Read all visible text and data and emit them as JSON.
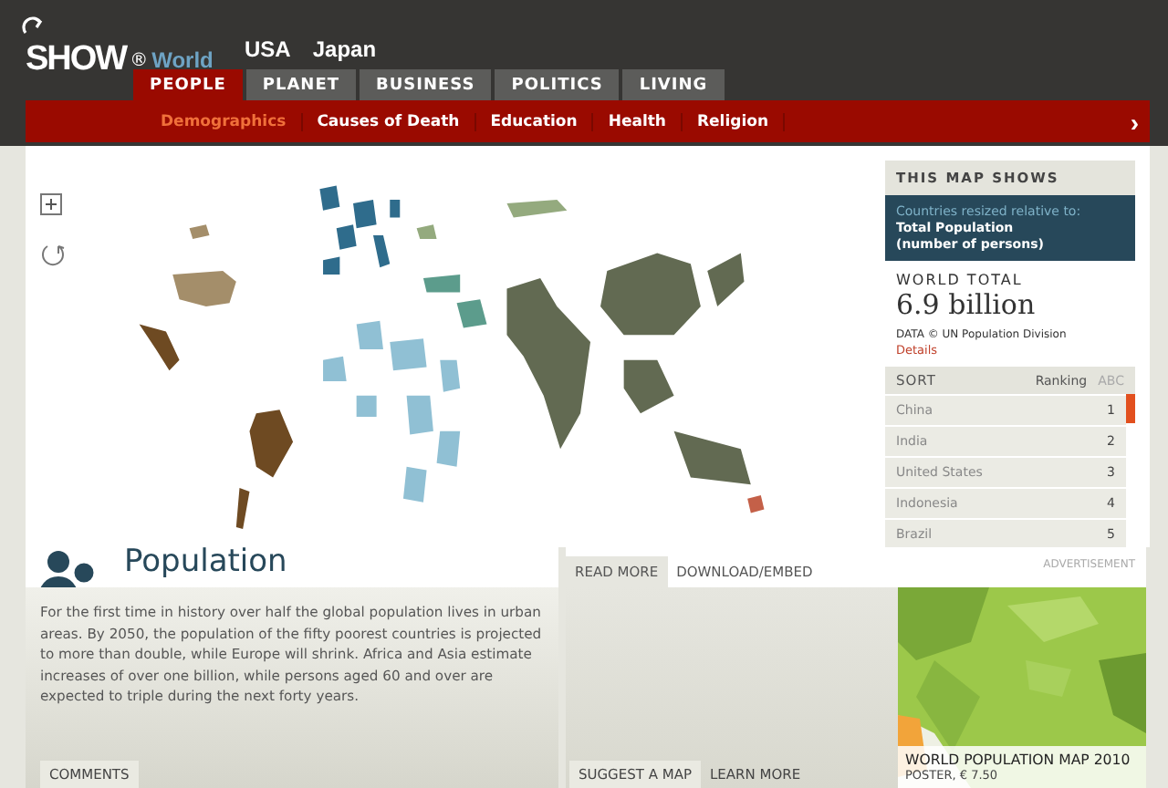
{
  "header": {
    "logo": "SHOW",
    "registered": "®",
    "section": "World",
    "editions": [
      "USA",
      "Japan"
    ]
  },
  "tabs": [
    {
      "label": "PEOPLE",
      "selected": true
    },
    {
      "label": "PLANET",
      "selected": false
    },
    {
      "label": "BUSINESS",
      "selected": false
    },
    {
      "label": "POLITICS",
      "selected": false
    },
    {
      "label": "LIVING",
      "selected": false
    }
  ],
  "subnav": {
    "items": [
      {
        "label": "Demographics",
        "selected": true
      },
      {
        "label": "Causes of Death",
        "selected": false
      },
      {
        "label": "Education",
        "selected": false
      },
      {
        "label": "Health",
        "selected": false
      },
      {
        "label": "Religion",
        "selected": false
      }
    ],
    "next": "›"
  },
  "sidebar": {
    "heading": "THIS MAP SHOWS",
    "intro": "Countries resized relative to:",
    "measure": "Total Population",
    "unit": "(number of persons)",
    "total_label": "WORLD TOTAL",
    "total_value": "6.9 billion",
    "source": "DATA © UN Population Division",
    "details": "Details",
    "sort_label": "SORT",
    "sort_options": [
      {
        "label": "Ranking",
        "selected": true
      },
      {
        "label": "ABC",
        "selected": false
      }
    ],
    "rows": [
      {
        "name": "China",
        "rank": "1"
      },
      {
        "name": "India",
        "rank": "2"
      },
      {
        "name": "United States",
        "rank": "3"
      },
      {
        "name": "Indonesia",
        "rank": "4"
      },
      {
        "name": "Brazil",
        "rank": "5"
      }
    ]
  },
  "topic": {
    "title": "Population",
    "text": "For the first time in history over half the global population lives in urban areas. By 2050, the population of the fifty poorest countries is projected to more than double, while Europe will shrink. Africa and Asia estimate increases of over one billion, while persons aged 60 and over are expected to triple during the next forty years.",
    "comments": "COMMENTS"
  },
  "info_tabs": [
    {
      "label": "READ MORE",
      "selected": true
    },
    {
      "label": "DOWNLOAD/EMBED",
      "selected": false
    }
  ],
  "info_links": [
    "SUGGEST A MAP",
    "LEARN MORE"
  ],
  "ad": {
    "label": "ADVERTISEMENT",
    "title": "WORLD POPULATION MAP 2010",
    "price": "POSTER, € 7.50"
  }
}
